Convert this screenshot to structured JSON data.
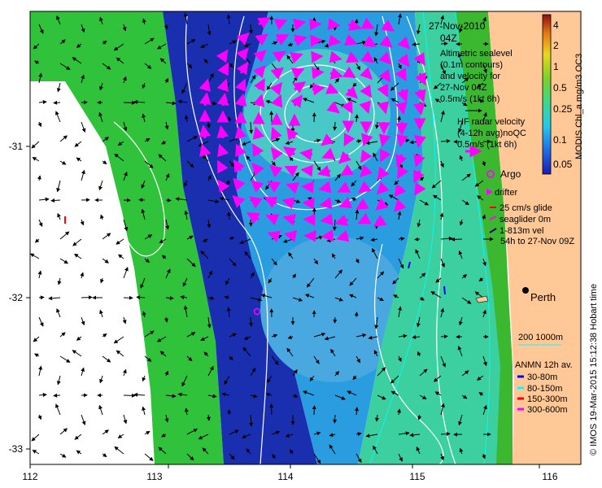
{
  "map": {
    "header": {
      "date": "27-Nov-2010",
      "time": "04Z"
    },
    "altimetry": {
      "lines": [
        "Altimetric sealevel",
        "(0.1m contours)",
        "and velocity for",
        "27-Nov 04Z",
        "0.5m/s (1kt 6h)"
      ]
    },
    "hf_radar": {
      "lines": [
        "HF radar velocity",
        "(4-12h avg)noQC",
        "0.5m/s (1kt 6h)"
      ],
      "color": "#ff00ff"
    },
    "legend": {
      "argo": "Argo",
      "drifter": "drifter",
      "glide": "25 cm/s glide",
      "seaglider": "seaglider 0m",
      "vel": "1-813m vel",
      "vel_period": "54h to 27-Nov 09Z"
    },
    "city": "Perth",
    "depth_legend": "200  1000m",
    "anmn": {
      "title": "ANMN 12h av.",
      "items": [
        {
          "label": "30-80m",
          "color": "#0000ff"
        },
        {
          "label": "80-150m",
          "color": "#00ffff"
        },
        {
          "label": "150-300m",
          "color": "#ff0000"
        },
        {
          "label": "300-600m",
          "color": "#ff00ff"
        }
      ]
    },
    "colorbar": {
      "title": "MODIS Chl_a mg/m3 OC3",
      "ticks": [
        "4",
        "2",
        "1",
        "0.5",
        "0.25",
        "0.1",
        "0.05"
      ]
    },
    "credit": "© IMOS 19-Mar-2015 15:12:38 Hobart time",
    "x_ticks": [
      "112",
      "113",
      "114",
      "115",
      "116"
    ],
    "y_ticks": [
      "-31",
      "-32",
      "-33"
    ]
  }
}
